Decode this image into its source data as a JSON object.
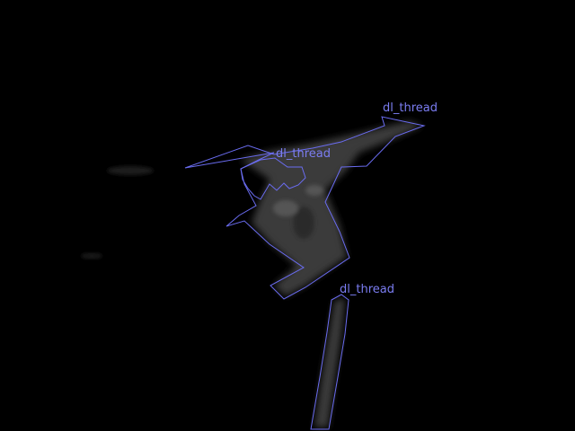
{
  "colors": {
    "background": "#000000",
    "outline": "#6a6cf0",
    "label": "#7b7df2",
    "blob_fill": "#3a3a3a",
    "blob_shadow": "#2a2a2a",
    "blob_highlight": "#555555"
  },
  "annotations": [
    {
      "label": "dl_thread"
    },
    {
      "label": "dl_thread"
    },
    {
      "label": "dl_thread"
    }
  ]
}
